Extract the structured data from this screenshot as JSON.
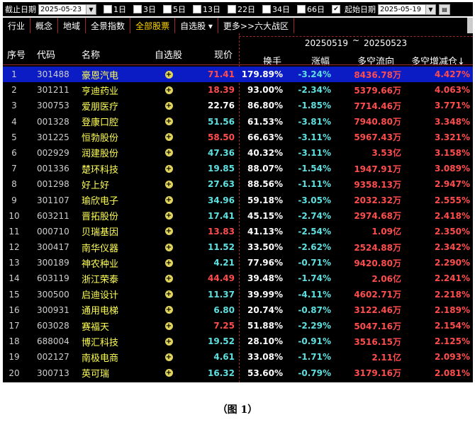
{
  "filter": {
    "end_date_label": "截止日期",
    "end_date": "2025-05-23",
    "periods": [
      {
        "label": "1日",
        "checked": false
      },
      {
        "label": "3日",
        "checked": false
      },
      {
        "label": "5日",
        "checked": false
      },
      {
        "label": "13日",
        "checked": false
      },
      {
        "label": "22日",
        "checked": false
      },
      {
        "label": "34日",
        "checked": false
      },
      {
        "label": "66日",
        "checked": false
      },
      {
        "label": "",
        "checked": true
      }
    ],
    "start_date_label": "起始日期",
    "start_date": "2025-05-19"
  },
  "tabs": [
    {
      "label": "行业",
      "active": false
    },
    {
      "label": "概念",
      "active": false
    },
    {
      "label": "地域",
      "active": false
    },
    {
      "label": "全景指数",
      "active": false
    },
    {
      "label": "全部股票",
      "active": true
    },
    {
      "label": "自选股 ▾",
      "active": false
    },
    {
      "label": "更多>>六大战区",
      "active": false
    }
  ],
  "range": {
    "start": "20250519",
    "sep": "~",
    "end": "20250523"
  },
  "headers": {
    "idx": "序号",
    "code": "代码",
    "name": "名称",
    "fav": "自选股",
    "price": "现价",
    "turnover": "换手",
    "change": "涨幅",
    "flow": "多空流向",
    "delta": "多空增减仓↓"
  },
  "colors": {
    "up": "#ff4d4d",
    "down": "#5ee0e0",
    "flat": "#ffffff",
    "name": "#ffff55",
    "selected_row": "#0c1cc4"
  },
  "rows": [
    {
      "idx": "1",
      "code": "301488",
      "name": "豪恩汽电",
      "price": "71.41",
      "dir": "up",
      "turnover": "179.89%",
      "change": "-3.24%",
      "flow": "8436.78万",
      "delta": "4.427%"
    },
    {
      "idx": "2",
      "code": "301211",
      "name": "亨迪药业",
      "price": "18.39",
      "dir": "up",
      "turnover": "93.00%",
      "change": "-2.34%",
      "flow": "5379.66万",
      "delta": "4.063%"
    },
    {
      "idx": "3",
      "code": "300753",
      "name": "爱朋医疗",
      "price": "22.76",
      "dir": "flat",
      "turnover": "86.80%",
      "change": "-1.85%",
      "flow": "7714.46万",
      "delta": "3.771%"
    },
    {
      "idx": "4",
      "code": "001328",
      "name": "登康口腔",
      "price": "51.56",
      "dir": "down",
      "turnover": "61.53%",
      "change": "-3.81%",
      "flow": "7940.80万",
      "delta": "3.348%"
    },
    {
      "idx": "5",
      "code": "301225",
      "name": "恒勃股份",
      "price": "58.50",
      "dir": "up",
      "turnover": "66.63%",
      "change": "-3.11%",
      "flow": "5967.43万",
      "delta": "3.321%"
    },
    {
      "idx": "6",
      "code": "002929",
      "name": "润建股份",
      "price": "47.36",
      "dir": "down",
      "turnover": "40.32%",
      "change": "-3.11%",
      "flow": "3.53亿",
      "delta": "3.158%"
    },
    {
      "idx": "7",
      "code": "001336",
      "name": "楚环科技",
      "price": "19.85",
      "dir": "down",
      "turnover": "88.07%",
      "change": "-1.54%",
      "flow": "1947.91万",
      "delta": "3.089%"
    },
    {
      "idx": "8",
      "code": "001298",
      "name": "好上好",
      "price": "27.63",
      "dir": "down",
      "turnover": "88.56%",
      "change": "-1.11%",
      "flow": "9358.13万",
      "delta": "2.947%"
    },
    {
      "idx": "9",
      "code": "301107",
      "name": "瑜欣电子",
      "price": "34.96",
      "dir": "down",
      "turnover": "59.18%",
      "change": "-3.05%",
      "flow": "2032.32万",
      "delta": "2.555%"
    },
    {
      "idx": "10",
      "code": "603211",
      "name": "晋拓股份",
      "price": "17.41",
      "dir": "down",
      "turnover": "45.15%",
      "change": "-2.74%",
      "flow": "2974.68万",
      "delta": "2.418%"
    },
    {
      "idx": "11",
      "code": "000710",
      "name": "贝瑞基因",
      "price": "13.83",
      "dir": "up",
      "turnover": "41.13%",
      "change": "-2.54%",
      "flow": "1.09亿",
      "delta": "2.350%"
    },
    {
      "idx": "12",
      "code": "300417",
      "name": "南华仪器",
      "price": "11.52",
      "dir": "down",
      "turnover": "33.50%",
      "change": "-2.62%",
      "flow": "2524.88万",
      "delta": "2.342%"
    },
    {
      "idx": "13",
      "code": "300189",
      "name": "神农种业",
      "price": "4.21",
      "dir": "down",
      "turnover": "77.96%",
      "change": "-0.71%",
      "flow": "9420.80万",
      "delta": "2.290%"
    },
    {
      "idx": "14",
      "code": "603119",
      "name": "浙江荣泰",
      "price": "44.49",
      "dir": "up",
      "turnover": "39.48%",
      "change": "-1.74%",
      "flow": "2.06亿",
      "delta": "2.241%"
    },
    {
      "idx": "15",
      "code": "300500",
      "name": "启迪设计",
      "price": "11.37",
      "dir": "down",
      "turnover": "39.99%",
      "change": "-4.11%",
      "flow": "4602.71万",
      "delta": "2.218%"
    },
    {
      "idx": "16",
      "code": "300931",
      "name": "通用电梯",
      "price": "6.80",
      "dir": "down",
      "turnover": "20.74%",
      "change": "-0.87%",
      "flow": "3122.46万",
      "delta": "2.189%"
    },
    {
      "idx": "17",
      "code": "603028",
      "name": "赛福天",
      "price": "7.25",
      "dir": "up",
      "turnover": "51.88%",
      "change": "-2.29%",
      "flow": "5047.16万",
      "delta": "2.154%"
    },
    {
      "idx": "18",
      "code": "688004",
      "name": "博汇科技",
      "price": "19.52",
      "dir": "down",
      "turnover": "28.10%",
      "change": "-0.91%",
      "flow": "3516.15万",
      "delta": "2.125%"
    },
    {
      "idx": "19",
      "code": "002127",
      "name": "南极电商",
      "price": "4.61",
      "dir": "down",
      "turnover": "33.08%",
      "change": "-1.71%",
      "flow": "2.11亿",
      "delta": "2.093%"
    },
    {
      "idx": "20",
      "code": "300713",
      "name": "英可瑞",
      "price": "16.32",
      "dir": "down",
      "turnover": "53.60%",
      "change": "-0.79%",
      "flow": "3179.16万",
      "delta": "2.081%"
    }
  ],
  "caption": "（图 1）"
}
